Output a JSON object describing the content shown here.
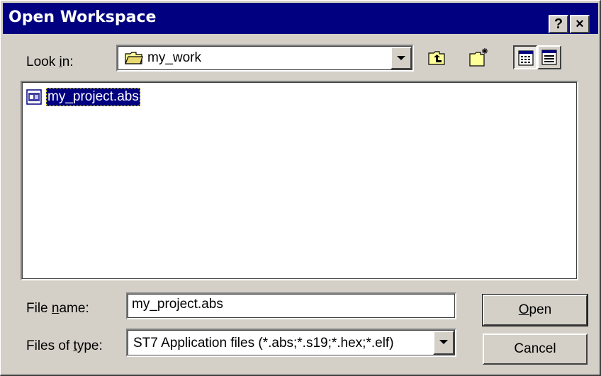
{
  "window": {
    "title": "Open Workspace",
    "help_btn": "?",
    "close_btn": "×"
  },
  "look_in": {
    "label_pre": "Look ",
    "label_u": "i",
    "label_post": "n:",
    "value": "my_work",
    "icon": "folder-icon"
  },
  "toolbar": {
    "up_folder_icon": "up-folder-icon",
    "new_folder_icon": "new-folder-icon",
    "list_view_icon": "list-view-icon",
    "details_view_icon": "details-view-icon"
  },
  "files": [
    {
      "name": "my_project.abs",
      "icon": "abs-file-icon",
      "selected": true
    }
  ],
  "file_name": {
    "label_pre": "File ",
    "label_u": "n",
    "label_post": "ame:",
    "value": "my_project.abs"
  },
  "file_type": {
    "label_pre": "Files of ",
    "label_u": "t",
    "label_post": "ype:",
    "value": "ST7 Application files (*.abs;*.s19;*.hex;*.elf)"
  },
  "buttons": {
    "open_u": "O",
    "open_rest": "pen",
    "cancel": "Cancel"
  },
  "colors": {
    "titlebar": "#000080",
    "face": "#d4d0c8",
    "selection": "#000080"
  }
}
